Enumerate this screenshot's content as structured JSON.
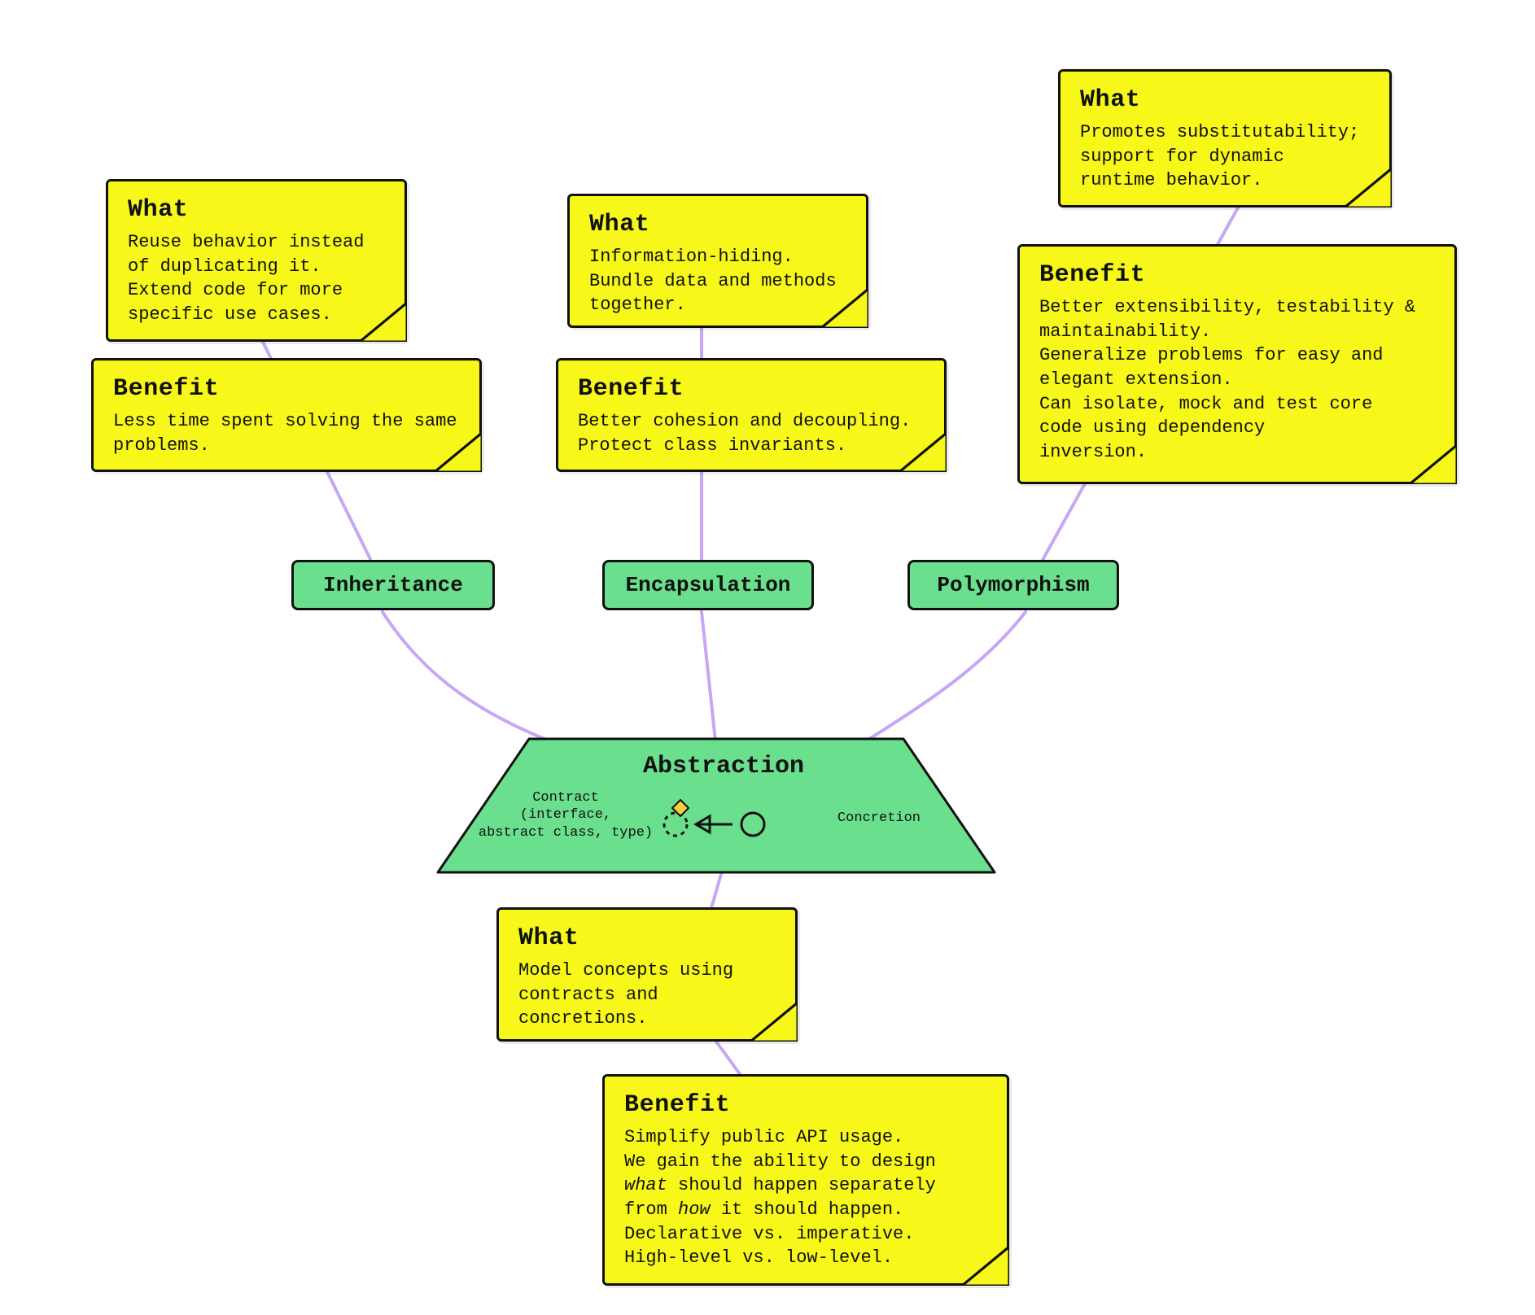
{
  "pillars": {
    "inheritance": {
      "label": "Inheritance",
      "what_title": "What",
      "what_body": "Reuse behavior instead\nof duplicating it.\nExtend code for more\nspecific use cases.",
      "benefit_title": "Benefit",
      "benefit_body": "Less time spent solving the same\nproblems."
    },
    "encapsulation": {
      "label": "Encapsulation",
      "what_title": "What",
      "what_body": "Information-hiding.\nBundle data and methods\ntogether.",
      "benefit_title": "Benefit",
      "benefit_body": "Better cohesion and decoupling.\nProtect class invariants."
    },
    "polymorphism": {
      "label": "Polymorphism",
      "what_title": "What",
      "what_body": "Promotes substitutability;\nsupport for dynamic\nruntime behavior.",
      "benefit_title": "Benefit",
      "benefit_body": "Better extensibility, testability &\nmaintainability.\nGeneralize problems for easy and\nelegant extension.\nCan isolate, mock and test core\ncode using dependency\ninversion."
    }
  },
  "abstraction": {
    "title": "Abstraction",
    "contract_label": "Contract\n(interface,\nabstract class, type)",
    "concretion_label": "Concretion",
    "what_title": "What",
    "what_body": "Model concepts using\ncontracts and\nconcretions.",
    "benefit_title": "Benefit",
    "benefit_body_html": "Simplify public API usage.\nWe gain the ability to design\n<i>what</i> should happen separately\nfrom <i>how</i> it should happen.\nDeclarative vs. imperative.\nHigh-level vs. low-level."
  },
  "colors": {
    "sticky": "#f7f71a",
    "pill": "#6adf8d",
    "connector": "#c7a7f5",
    "ink": "#111111"
  }
}
